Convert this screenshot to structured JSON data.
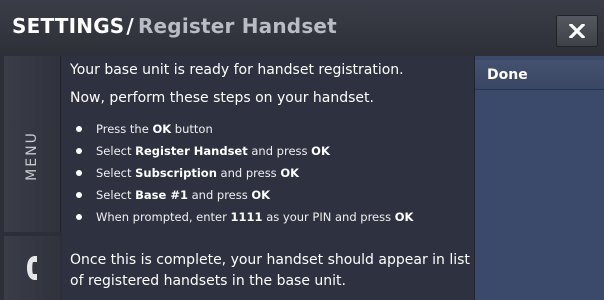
{
  "header": {
    "breadcrumb_root": "SETTINGS",
    "breadcrumb_separator": "/",
    "page_title": "Register Handset",
    "close_icon": "close-x-icon"
  },
  "sidebar": {
    "menu_label": "MENU",
    "phone_icon": "phone-handset-icon"
  },
  "content": {
    "line1": "Your base unit is ready for handset registration.",
    "line2": "Now, perform these steps on your handset.",
    "steps": [
      {
        "before": "Press the ",
        "strong": "OK",
        "after": " button",
        "strong2": ""
      },
      {
        "before": "Select ",
        "strong": "Register Handset",
        "after": " and press ",
        "strong2": "OK"
      },
      {
        "before": "Select ",
        "strong": "Subscription",
        "after": " and press ",
        "strong2": "OK"
      },
      {
        "before": "Select ",
        "strong": "Base #1",
        "after": " and press ",
        "strong2": "OK"
      },
      {
        "before": "When prompted, enter ",
        "strong": "1111",
        "after": " as your PIN and press ",
        "strong2": "OK"
      }
    ],
    "closing": "Once this is complete, your handset should appear in list of registered handsets in the base unit."
  },
  "right_panel": {
    "done_label": "Done"
  }
}
